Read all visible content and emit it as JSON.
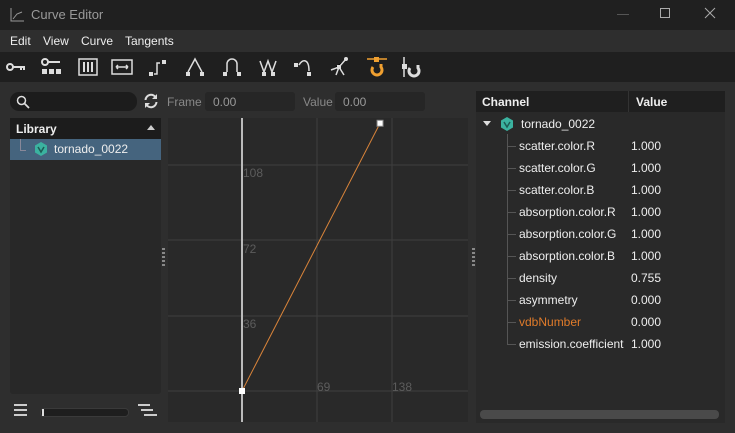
{
  "window": {
    "title": "Curve Editor"
  },
  "menu": [
    "Edit",
    "View",
    "Curve",
    "Tangents"
  ],
  "toolbar": [
    "key-icon",
    "key-group-icon",
    "columns-icon",
    "fit-horizontal-icon",
    "step-tangent-icon",
    "linear-tangent-icon",
    "smooth-tangent-icon",
    "broken-tangent-icon",
    "flat-tangent-icon",
    "spline-tangent-icon",
    "magnet-snap-icon",
    "magnet-align-icon"
  ],
  "accent": "#f0a030",
  "search": {
    "placeholder": ""
  },
  "frame": {
    "label": "Frame",
    "value": "0.00"
  },
  "value": {
    "label": "Value",
    "value": "0.00"
  },
  "library": {
    "title": "Library",
    "items": [
      {
        "label": "tornado_0022"
      }
    ]
  },
  "curve": {
    "x_ticks": [
      "69",
      "138"
    ],
    "y_ticks": [
      "108",
      "72",
      "36"
    ],
    "keys": [
      [
        0,
        0
      ],
      [
        127,
        128
      ]
    ],
    "color": "#d9843a"
  },
  "channels": {
    "col_channel": "Channel",
    "col_value": "Value",
    "root": "tornado_0022",
    "rows": [
      {
        "name": "scatter.color.R",
        "value": "1.000"
      },
      {
        "name": "scatter.color.G",
        "value": "1.000"
      },
      {
        "name": "scatter.color.B",
        "value": "1.000"
      },
      {
        "name": "absorption.color.R",
        "value": "1.000"
      },
      {
        "name": "absorption.color.G",
        "value": "1.000"
      },
      {
        "name": "absorption.color.B",
        "value": "1.000"
      },
      {
        "name": "density",
        "value": "0.755"
      },
      {
        "name": "asymmetry",
        "value": "0.000"
      },
      {
        "name": "vdbNumber",
        "value": "0.000",
        "highlight": true
      },
      {
        "name": "emission.coefficient",
        "value": "1.000"
      }
    ]
  }
}
